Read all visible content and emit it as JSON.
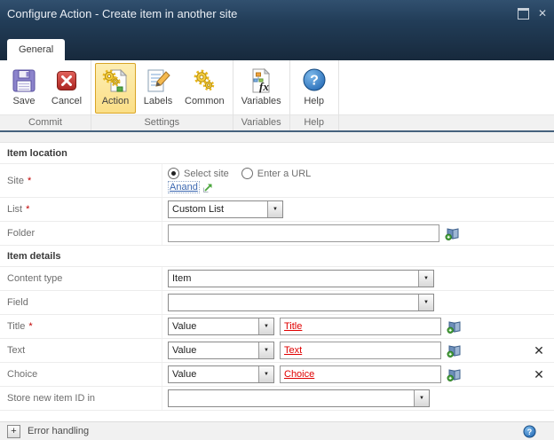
{
  "window": {
    "title": "Configure Action - Create item in another site"
  },
  "tab": {
    "label": "General"
  },
  "ribbon": {
    "groups": [
      {
        "label": "Commit",
        "buttons": [
          {
            "label": "Save"
          },
          {
            "label": "Cancel"
          }
        ]
      },
      {
        "label": "Settings",
        "buttons": [
          {
            "label": "Action",
            "active": true
          },
          {
            "label": "Labels"
          },
          {
            "label": "Common"
          }
        ]
      },
      {
        "label": "Variables",
        "buttons": [
          {
            "label": "Variables"
          }
        ]
      },
      {
        "label": "Help",
        "buttons": [
          {
            "label": "Help"
          }
        ]
      }
    ],
    "active_button": "Action"
  },
  "form": {
    "sections": {
      "item_location": {
        "heading": "Item location"
      },
      "item_details": {
        "heading": "Item details"
      }
    },
    "site": {
      "label": "Site",
      "required": "*",
      "options": [
        {
          "label": "Select site",
          "selected": true
        },
        {
          "label": "Enter a URL",
          "selected": false
        }
      ],
      "link": "Anand"
    },
    "list": {
      "label": "List",
      "required": "*",
      "value": "Custom List"
    },
    "folder": {
      "label": "Folder",
      "value": ""
    },
    "content_type": {
      "label": "Content type",
      "value": "Item"
    },
    "field": {
      "label": "Field",
      "value": ""
    },
    "title_row": {
      "label": "Title",
      "required": "*",
      "source": "Value",
      "value": "Title"
    },
    "text_row": {
      "label": "Text",
      "source": "Value",
      "value": "Text"
    },
    "choice_row": {
      "label": "Choice",
      "source": "Value",
      "value": "Choice"
    },
    "store_id": {
      "label": "Store new item ID in",
      "value": ""
    }
  },
  "error_handling": {
    "label": "Error handling"
  },
  "icons": {
    "maximize": "window-square",
    "close": "✕",
    "save": "purple-floppy-disk",
    "cancel": "red-x-square",
    "action": "gears-on-page",
    "labels": "notepad-with-pencil",
    "common": "yellow-gears",
    "variables": "fx-page",
    "help": "blue-question-circle",
    "lookup": "book-with-green-plus",
    "external_link": "green-ne-arrow",
    "remove": "✕",
    "expand": "+"
  },
  "colors": {
    "titlebar": "#223d58",
    "action_highlight": "#fbdf87",
    "action_border": "#d8a426",
    "required": "#c00000",
    "link": "#3a66b0",
    "red_value": "#e00000",
    "group_bar": "#f1f1f1"
  }
}
